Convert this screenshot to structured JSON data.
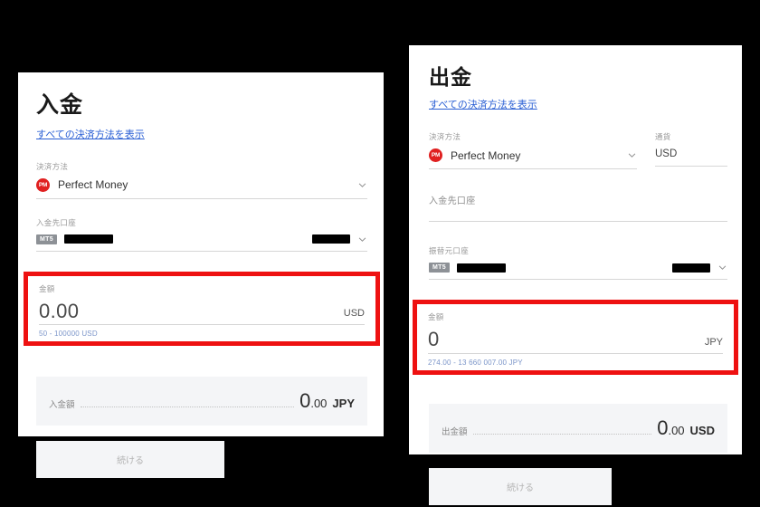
{
  "deposit": {
    "title": "入金",
    "all_methods_link": "すべての決済方法を表示",
    "method_label": "決済方法",
    "method_name": "Perfect Money",
    "method_icon": "perfect-money-icon",
    "account_label": "入金先口座",
    "account_badge": "MT5",
    "amount_label": "金額",
    "amount_value": "0.00",
    "amount_currency": "USD",
    "amount_hint": "50 - 100000 USD",
    "total_label": "入金額",
    "total_int": "0",
    "total_dec": ".00",
    "total_currency": "JPY",
    "continue_label": "続ける"
  },
  "withdraw": {
    "title": "出金",
    "all_methods_link": "すべての決済方法を表示",
    "method_label": "決済方法",
    "method_name": "Perfect Money",
    "method_icon": "perfect-money-icon",
    "currency_label": "通貨",
    "currency_value": "USD",
    "deposit_account_label": "入金先口座",
    "source_account_label": "振替元口座",
    "account_badge": "MT5",
    "amount_label": "金額",
    "amount_value": "0",
    "amount_currency": "JPY",
    "amount_hint": "274.00 - 13 660 007.00 JPY",
    "total_label": "出金額",
    "total_int": "0",
    "total_dec": ".00",
    "total_currency": "USD",
    "continue_label": "続ける"
  },
  "colors": {
    "highlight": "#ee1111",
    "link": "#2a5fd4",
    "brand": "#e02020",
    "background": "#000000"
  }
}
